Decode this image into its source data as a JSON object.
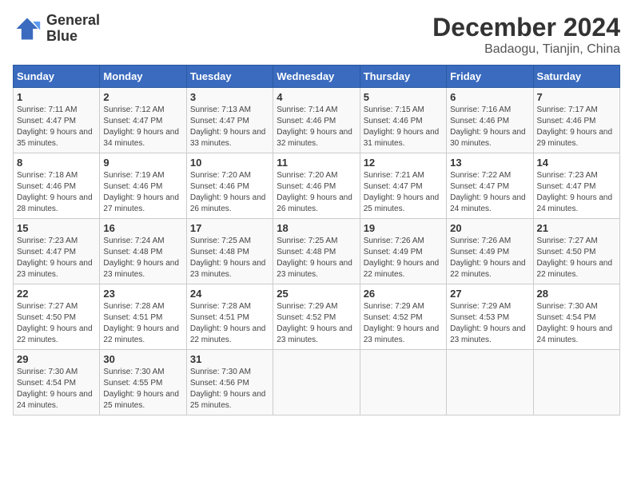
{
  "logo": {
    "line1": "General",
    "line2": "Blue"
  },
  "title": "December 2024",
  "subtitle": "Badaogu, Tianjin, China",
  "header": {
    "days": [
      "Sunday",
      "Monday",
      "Tuesday",
      "Wednesday",
      "Thursday",
      "Friday",
      "Saturday"
    ]
  },
  "weeks": [
    [
      {
        "day": "1",
        "sunrise": "7:11 AM",
        "sunset": "4:47 PM",
        "daylight": "9 hours and 35 minutes."
      },
      {
        "day": "2",
        "sunrise": "7:12 AM",
        "sunset": "4:47 PM",
        "daylight": "9 hours and 34 minutes."
      },
      {
        "day": "3",
        "sunrise": "7:13 AM",
        "sunset": "4:47 PM",
        "daylight": "9 hours and 33 minutes."
      },
      {
        "day": "4",
        "sunrise": "7:14 AM",
        "sunset": "4:46 PM",
        "daylight": "9 hours and 32 minutes."
      },
      {
        "day": "5",
        "sunrise": "7:15 AM",
        "sunset": "4:46 PM",
        "daylight": "9 hours and 31 minutes."
      },
      {
        "day": "6",
        "sunrise": "7:16 AM",
        "sunset": "4:46 PM",
        "daylight": "9 hours and 30 minutes."
      },
      {
        "day": "7",
        "sunrise": "7:17 AM",
        "sunset": "4:46 PM",
        "daylight": "9 hours and 29 minutes."
      }
    ],
    [
      {
        "day": "8",
        "sunrise": "7:18 AM",
        "sunset": "4:46 PM",
        "daylight": "9 hours and 28 minutes."
      },
      {
        "day": "9",
        "sunrise": "7:19 AM",
        "sunset": "4:46 PM",
        "daylight": "9 hours and 27 minutes."
      },
      {
        "day": "10",
        "sunrise": "7:20 AM",
        "sunset": "4:46 PM",
        "daylight": "9 hours and 26 minutes."
      },
      {
        "day": "11",
        "sunrise": "7:20 AM",
        "sunset": "4:46 PM",
        "daylight": "9 hours and 26 minutes."
      },
      {
        "day": "12",
        "sunrise": "7:21 AM",
        "sunset": "4:47 PM",
        "daylight": "9 hours and 25 minutes."
      },
      {
        "day": "13",
        "sunrise": "7:22 AM",
        "sunset": "4:47 PM",
        "daylight": "9 hours and 24 minutes."
      },
      {
        "day": "14",
        "sunrise": "7:23 AM",
        "sunset": "4:47 PM",
        "daylight": "9 hours and 24 minutes."
      }
    ],
    [
      {
        "day": "15",
        "sunrise": "7:23 AM",
        "sunset": "4:47 PM",
        "daylight": "9 hours and 23 minutes."
      },
      {
        "day": "16",
        "sunrise": "7:24 AM",
        "sunset": "4:48 PM",
        "daylight": "9 hours and 23 minutes."
      },
      {
        "day": "17",
        "sunrise": "7:25 AM",
        "sunset": "4:48 PM",
        "daylight": "9 hours and 23 minutes."
      },
      {
        "day": "18",
        "sunrise": "7:25 AM",
        "sunset": "4:48 PM",
        "daylight": "9 hours and 23 minutes."
      },
      {
        "day": "19",
        "sunrise": "7:26 AM",
        "sunset": "4:49 PM",
        "daylight": "9 hours and 22 minutes."
      },
      {
        "day": "20",
        "sunrise": "7:26 AM",
        "sunset": "4:49 PM",
        "daylight": "9 hours and 22 minutes."
      },
      {
        "day": "21",
        "sunrise": "7:27 AM",
        "sunset": "4:50 PM",
        "daylight": "9 hours and 22 minutes."
      }
    ],
    [
      {
        "day": "22",
        "sunrise": "7:27 AM",
        "sunset": "4:50 PM",
        "daylight": "9 hours and 22 minutes."
      },
      {
        "day": "23",
        "sunrise": "7:28 AM",
        "sunset": "4:51 PM",
        "daylight": "9 hours and 22 minutes."
      },
      {
        "day": "24",
        "sunrise": "7:28 AM",
        "sunset": "4:51 PM",
        "daylight": "9 hours and 22 minutes."
      },
      {
        "day": "25",
        "sunrise": "7:29 AM",
        "sunset": "4:52 PM",
        "daylight": "9 hours and 23 minutes."
      },
      {
        "day": "26",
        "sunrise": "7:29 AM",
        "sunset": "4:52 PM",
        "daylight": "9 hours and 23 minutes."
      },
      {
        "day": "27",
        "sunrise": "7:29 AM",
        "sunset": "4:53 PM",
        "daylight": "9 hours and 23 minutes."
      },
      {
        "day": "28",
        "sunrise": "7:30 AM",
        "sunset": "4:54 PM",
        "daylight": "9 hours and 24 minutes."
      }
    ],
    [
      {
        "day": "29",
        "sunrise": "7:30 AM",
        "sunset": "4:54 PM",
        "daylight": "9 hours and 24 minutes."
      },
      {
        "day": "30",
        "sunrise": "7:30 AM",
        "sunset": "4:55 PM",
        "daylight": "9 hours and 25 minutes."
      },
      {
        "day": "31",
        "sunrise": "7:30 AM",
        "sunset": "4:56 PM",
        "daylight": "9 hours and 25 minutes."
      },
      null,
      null,
      null,
      null
    ]
  ],
  "labels": {
    "sunrise": "Sunrise:",
    "sunset": "Sunset:",
    "daylight": "Daylight:"
  }
}
